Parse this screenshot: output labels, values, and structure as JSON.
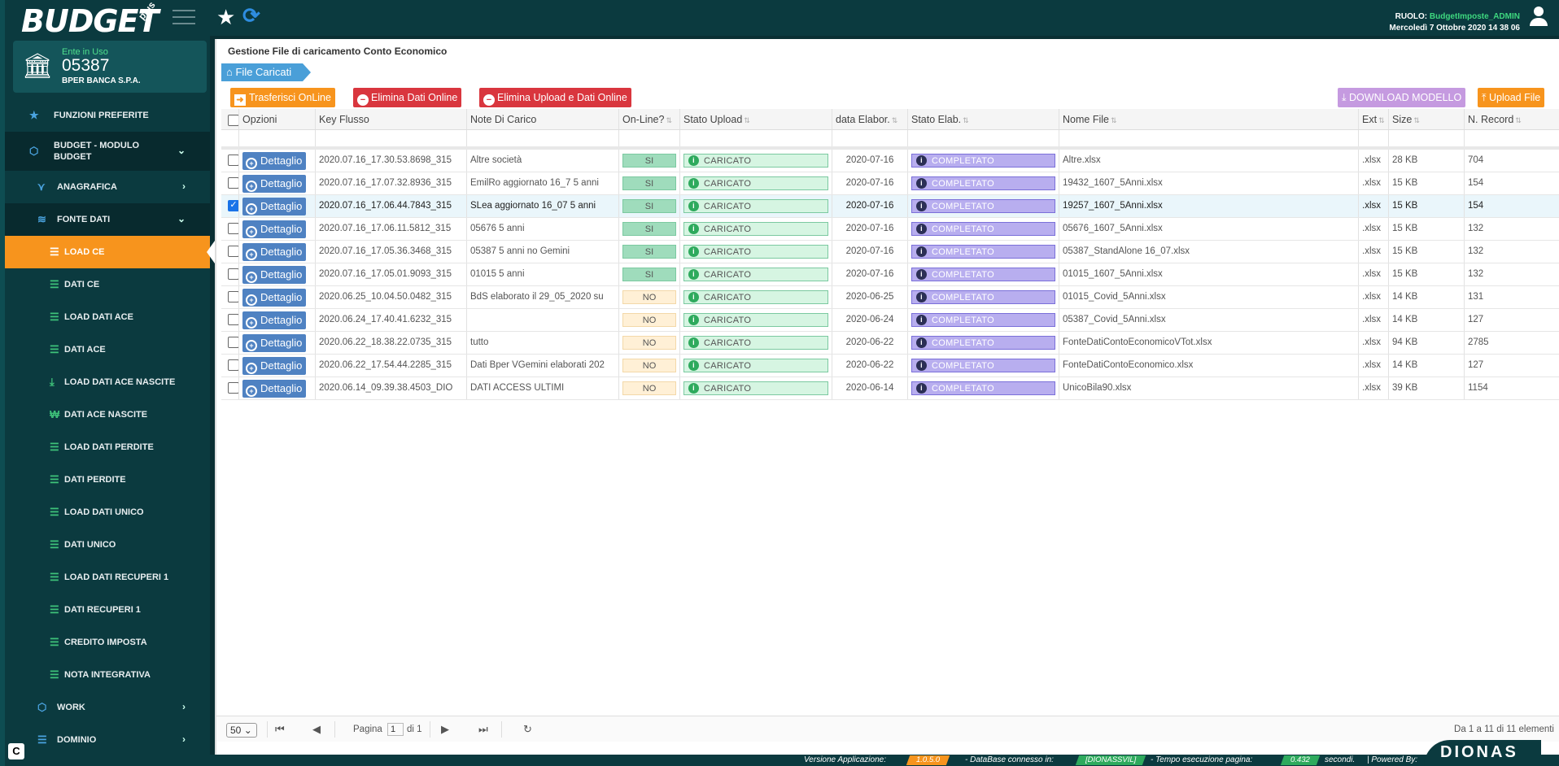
{
  "app": {
    "logo": "BUDGET",
    "logo_plus": "plus"
  },
  "ente": {
    "label": "Ente in Uso",
    "code": "05387",
    "name": "BPER BANCA S.P.A."
  },
  "menu": [
    {
      "label": "FUNZIONI PREFERITE",
      "icon": "star-icon"
    },
    {
      "label": "BUDGET - MODULO BUDGET",
      "icon": "cube-icon"
    },
    {
      "label": "ANAGRAFICA",
      "icon": "sitemap-icon"
    },
    {
      "label": "FONTE DATI",
      "icon": "database-icon"
    },
    {
      "label": "LOAD CE",
      "icon": "list-icon"
    },
    {
      "label": "DATI CE",
      "icon": "list-icon"
    },
    {
      "label": "LOAD DATI ACE",
      "icon": "list-icon"
    },
    {
      "label": "DATI ACE",
      "icon": "list-icon"
    },
    {
      "label": "LOAD DATI ACE NASCITE",
      "icon": "download-icon"
    },
    {
      "label": "DATI ACE NASCITE",
      "icon": "won-icon"
    },
    {
      "label": "LOAD DATI PERDITE",
      "icon": "list-icon"
    },
    {
      "label": "DATI PERDITE",
      "icon": "list-icon"
    },
    {
      "label": "LOAD DATI UNICO",
      "icon": "list-icon"
    },
    {
      "label": "DATI UNICO",
      "icon": "list-icon"
    },
    {
      "label": "LOAD DATI RECUPERI 1",
      "icon": "list-icon"
    },
    {
      "label": "DATI RECUPERI 1",
      "icon": "list-icon"
    },
    {
      "label": "CREDITO IMPOSTA",
      "icon": "list-icon"
    },
    {
      "label": "NOTA INTEGRATIVA",
      "icon": "list-icon"
    },
    {
      "label": "WORK",
      "icon": "cube-icon"
    },
    {
      "label": "DOMINIO",
      "icon": "list-icon"
    }
  ],
  "header": {
    "ruolo_label": "RUOLO:",
    "ruolo": "BudgetImposte_ADMIN",
    "datetime": "Mercoledì 7 Ottobre 2020  14 38 06"
  },
  "page": {
    "title": "Gestione File di caricamento Conto Economico",
    "breadcrumb": "File Caricati"
  },
  "toolbar": {
    "trasferisci": "Trasferisci OnLine",
    "elimina_online": "Elimina Dati Online",
    "elimina_upload": "Elimina Upload e Dati Online",
    "download_modello": "DOWNLOAD MODELLO",
    "upload_file": "Upload File"
  },
  "columns": [
    "Opzioni",
    "Key Flusso",
    "Note Di Carico",
    "On-Line?",
    "Stato Upload",
    "data Elabor.",
    "Stato Elab.",
    "Nome File",
    "Ext",
    "Size",
    "N. Record"
  ],
  "button_dettaglio": "Dettaglio",
  "rows": [
    {
      "key": "2020.07.16_17.30.53.8698_315",
      "note": "Altre società",
      "online": "SI",
      "upload": "CARICATO",
      "data": "2020-07-16",
      "elab": "COMPLETATO",
      "file": "Altre.xlsx",
      "ext": ".xlsx",
      "size": "28 KB",
      "rec": "704",
      "checked": false
    },
    {
      "key": "2020.07.16_17.07.32.8936_315",
      "note": "EmilRo aggiornato 16_7 5 anni",
      "online": "SI",
      "upload": "CARICATO",
      "data": "2020-07-16",
      "elab": "COMPLETATO",
      "file": "19432_1607_5Anni.xlsx",
      "ext": ".xlsx",
      "size": "15 KB",
      "rec": "154",
      "checked": false
    },
    {
      "key": "2020.07.16_17.06.44.7843_315",
      "note": "SLea aggiornato 16_07 5 anni",
      "online": "SI",
      "upload": "CARICATO",
      "data": "2020-07-16",
      "elab": "COMPLETATO",
      "file": "19257_1607_5Anni.xlsx",
      "ext": ".xlsx",
      "size": "15 KB",
      "rec": "154",
      "checked": true
    },
    {
      "key": "2020.07.16_17.06.11.5812_315",
      "note": "05676 5 anni",
      "online": "SI",
      "upload": "CARICATO",
      "data": "2020-07-16",
      "elab": "COMPLETATO",
      "file": "05676_1607_5Anni.xlsx",
      "ext": ".xlsx",
      "size": "15 KB",
      "rec": "132",
      "checked": false
    },
    {
      "key": "2020.07.16_17.05.36.3468_315",
      "note": "05387 5 anni no Gemini",
      "online": "SI",
      "upload": "CARICATO",
      "data": "2020-07-16",
      "elab": "COMPLETATO",
      "file": "05387_StandAlone 16_07.xlsx",
      "ext": ".xlsx",
      "size": "15 KB",
      "rec": "132",
      "checked": false
    },
    {
      "key": "2020.07.16_17.05.01.9093_315",
      "note": "01015 5 anni",
      "online": "SI",
      "upload": "CARICATO",
      "data": "2020-07-16",
      "elab": "COMPLETATO",
      "file": "01015_1607_5Anni.xlsx",
      "ext": ".xlsx",
      "size": "15 KB",
      "rec": "132",
      "checked": false
    },
    {
      "key": "2020.06.25_10.04.50.0482_315",
      "note": "BdS elaborato il 29_05_2020 su",
      "online": "NO",
      "upload": "CARICATO",
      "data": "2020-06-25",
      "elab": "COMPLETATO",
      "file": "01015_Covid_5Anni.xlsx",
      "ext": ".xlsx",
      "size": "14 KB",
      "rec": "131",
      "checked": false
    },
    {
      "key": "2020.06.24_17.40.41.6232_315",
      "note": "",
      "online": "NO",
      "upload": "CARICATO",
      "data": "2020-06-24",
      "elab": "COMPLETATO",
      "file": "05387_Covid_5Anni.xlsx",
      "ext": ".xlsx",
      "size": "14 KB",
      "rec": "127",
      "checked": false
    },
    {
      "key": "2020.06.22_18.38.22.0735_315",
      "note": "tutto",
      "online": "NO",
      "upload": "CARICATO",
      "data": "2020-06-22",
      "elab": "COMPLETATO",
      "file": "FonteDatiContoEconomicoVTot.xlsx",
      "ext": ".xlsx",
      "size": "94 KB",
      "rec": "2785",
      "checked": false
    },
    {
      "key": "2020.06.22_17.54.44.2285_315",
      "note": "Dati Bper VGemini elaborati 202",
      "online": "NO",
      "upload": "CARICATO",
      "data": "2020-06-22",
      "elab": "COMPLETATO",
      "file": "FonteDatiContoEconomico.xlsx",
      "ext": ".xlsx",
      "size": "14 KB",
      "rec": "127",
      "checked": false
    },
    {
      "key": "2020.06.14_09.39.38.4503_DIO",
      "note": "DATI ACCESS ULTIMI",
      "online": "NO",
      "upload": "CARICATO",
      "data": "2020-06-14",
      "elab": "COMPLETATO",
      "file": "UnicoBila90.xlsx",
      "ext": ".xlsx",
      "size": "39 KB",
      "rec": "1154",
      "checked": false
    }
  ],
  "pager": {
    "size": "50",
    "pagina_label": "Pagina",
    "page": "1",
    "di_label": "di 1",
    "summary": "Da 1 a 11 di 11 elementi"
  },
  "footer": {
    "versione_label": "Versione Applicazione:",
    "versione": "1.0.5.0",
    "db_label": "- DataBase connesso in:",
    "db": "[DIONASSVIL]",
    "tempo_label": "- Tempo esecuzione pagina:",
    "tempo": "0.432",
    "sec_label": "secondi.",
    "powered": "| Powered By:",
    "brand": "DIONAS"
  }
}
